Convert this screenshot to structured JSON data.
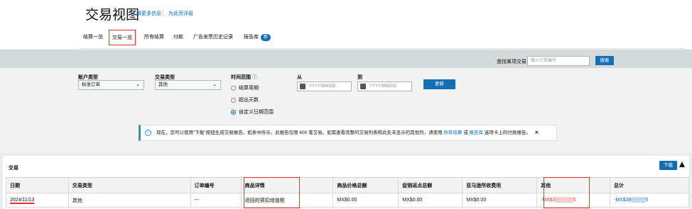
{
  "header": {
    "title": "交易视图",
    "links": [
      "了解更多信息",
      "为此页评级"
    ]
  },
  "tabs": [
    {
      "label": "结算一览"
    },
    {
      "label": "交易一览"
    },
    {
      "label": "所有结算"
    },
    {
      "label": "付款"
    },
    {
      "label": "广告发票历史记录"
    },
    {
      "label": "报告库",
      "badge": "新"
    }
  ],
  "search": {
    "label": "查找某项交易",
    "placeholder": "输入订单编号",
    "button": "搜索"
  },
  "filters": {
    "account_type": {
      "label": "账户类型",
      "value": "标准订单"
    },
    "transaction_type": {
      "label": "交易类型",
      "value": "其他"
    },
    "time_range": {
      "label": "时间范围",
      "options": [
        "结算周期",
        "超出天数",
        "自定义日期范围"
      ],
      "selected": "自定义日期范围"
    },
    "from": {
      "label": "从",
      "placeholder": "YYYY/MM/DD"
    },
    "to": {
      "label": "到",
      "placeholder": "YYYY/MM/DD"
    },
    "update_button": "更新"
  },
  "info_banner": {
    "text": "现在，您可以使用\"下载\"按钮生成交易报告，如表中所示。此报告仅限 600 笔交易。如需查看完整的交易列表和此处未显示的其他列，请使用",
    "link1": "所有结算",
    "or": "或",
    "link2": "报告库",
    "suffix": "选项卡上的付款报告。",
    "close": "✕"
  },
  "transactions": {
    "title": "交易",
    "download_button": "下载",
    "columns": [
      "日期",
      "交易类型",
      "订单编号",
      "商品详情",
      "商品价格总额",
      "促销返点总额",
      "亚马逊所收费用",
      "其他",
      "总计"
    ],
    "rows": [
      {
        "date": "2024/11/13",
        "type": "其他",
        "order": "---",
        "detail": "退回的预扣增值税",
        "price_total": "MX$0.00",
        "promo_total": "MX$0.00",
        "amazon_fees": "MX$0.00",
        "other": "-MX$3▒▒▒▒▒5",
        "total": "-MX$39▒▒▒▒5"
      }
    ]
  }
}
